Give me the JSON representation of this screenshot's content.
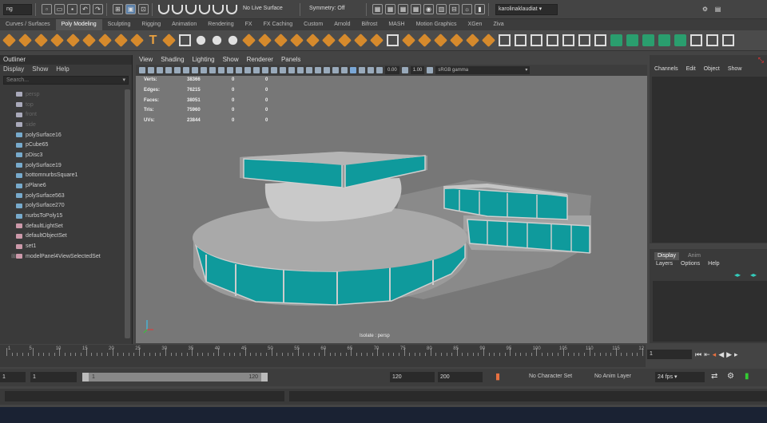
{
  "status_line": {
    "workspace_menu": "ng",
    "live_surface": "No Live Surface",
    "symmetry": "Symmetry: Off",
    "account": "karolinaklaudiat"
  },
  "shelf_tabs": [
    "Curves / Surfaces",
    "Poly Modeling",
    "Sculpting",
    "Rigging",
    "Animation",
    "Rendering",
    "FX",
    "FX Caching",
    "Custom",
    "Arnold",
    "Bifrost",
    "MASH",
    "Motion Graphics",
    "XGen",
    "Ziva"
  ],
  "shelf_active": "Poly Modeling",
  "outliner": {
    "title": "Outliner",
    "menus": [
      "Display",
      "Show",
      "Help"
    ],
    "search_placeholder": "Search...",
    "items": [
      {
        "label": "persp",
        "dim": true
      },
      {
        "label": "top",
        "dim": true
      },
      {
        "label": "front",
        "dim": true
      },
      {
        "label": "side",
        "dim": true
      },
      {
        "label": "polySurface16",
        "dim": false
      },
      {
        "label": "pCube65",
        "dim": false
      },
      {
        "label": "pDisc3",
        "dim": false
      },
      {
        "label": "polySurface19",
        "dim": false
      },
      {
        "label": "bottomnurbsSquare1",
        "dim": false
      },
      {
        "label": "pPlane6",
        "dim": false
      },
      {
        "label": "polySurface563",
        "dim": false
      },
      {
        "label": "polySurface270",
        "dim": false
      },
      {
        "label": "nurbsToPoly15",
        "dim": false
      },
      {
        "label": "defaultLightSet",
        "dim": false
      },
      {
        "label": "defaultObjectSet",
        "dim": false
      },
      {
        "label": "set1",
        "dim": false
      },
      {
        "label": "modelPanel4ViewSelectedSet",
        "dim": false
      }
    ]
  },
  "viewport": {
    "menus": [
      "View",
      "Shading",
      "Lighting",
      "Show",
      "Renderer",
      "Panels"
    ],
    "exposure": "0.00",
    "gamma": "1.00",
    "color_space": "sRGB gamma",
    "camera_label": "Isolate : persp",
    "hud": [
      {
        "label": "Verts:",
        "a": "38366",
        "b": "0",
        "c": "0"
      },
      {
        "label": "Edges:",
        "a": "76215",
        "b": "0",
        "c": "0"
      },
      {
        "label": "Faces:",
        "a": "38051",
        "b": "0",
        "c": "0"
      },
      {
        "label": "Tris:",
        "a": "75960",
        "b": "0",
        "c": "0"
      },
      {
        "label": "UVs:",
        "a": "23844",
        "b": "0",
        "c": "0"
      }
    ]
  },
  "channel_box": {
    "menus": [
      "Channels",
      "Edit",
      "Object",
      "Show"
    ]
  },
  "layer_editor": {
    "tabs": [
      "Display",
      "Anim"
    ],
    "menus": [
      "Layers",
      "Options",
      "Help"
    ]
  },
  "time_slider": {
    "ticks": [
      "1",
      "5",
      "10",
      "15",
      "20",
      "25",
      "30",
      "35",
      "40",
      "45",
      "50",
      "55",
      "60",
      "65",
      "70",
      "75",
      "80",
      "85",
      "90",
      "95",
      "100",
      "105",
      "110",
      "115",
      "12"
    ],
    "current_frame": "1"
  },
  "range_slider": {
    "start": "1",
    "inner_start": "1",
    "inner_end": "120",
    "end": "120",
    "anim_end": "200",
    "character_set": "No Character Set",
    "anim_layer": "No Anim Layer",
    "fps": "24 fps"
  },
  "colors": {
    "panel": "#3a3a3a",
    "viewport_bg": "#777777",
    "teal": "#0f9a9c",
    "gray_model": "#9a9a9a",
    "shelf_orange": "#d68a2c"
  }
}
